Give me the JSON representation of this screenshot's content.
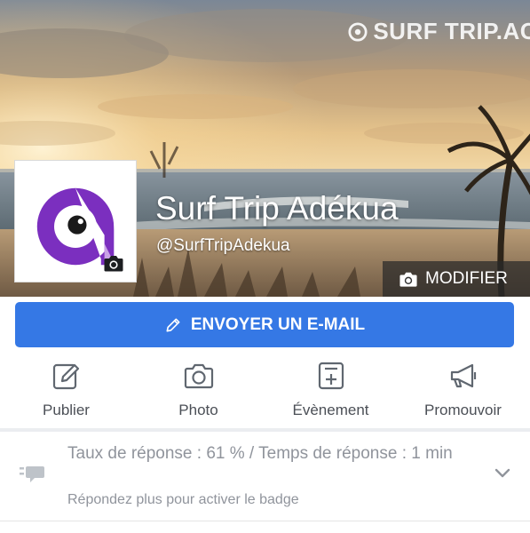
{
  "cover": {
    "watermark": "SURF TRIP.AC"
  },
  "page": {
    "name": "Surf Trip Adékua",
    "handle": "@SurfTripAdekua"
  },
  "buttons": {
    "modify_label": "MODIFIER",
    "email_label": "ENVOYER UN E-MAIL"
  },
  "actions": [
    {
      "label": "Publier",
      "icon": "edit-icon"
    },
    {
      "label": "Photo",
      "icon": "camera-icon"
    },
    {
      "label": "Évènement",
      "icon": "event-icon"
    },
    {
      "label": "Promouvoir",
      "icon": "megaphone-icon"
    }
  ],
  "response": {
    "title": "Taux de réponse : 61 % / Temps de réponse : 1 min",
    "subtitle": "Répondez plus pour activer le badge"
  },
  "colors": {
    "primary_button": "#3578e5",
    "brand_purple": "#7b2fbf",
    "muted_text": "#90949c",
    "action_text": "#4b4f56"
  }
}
